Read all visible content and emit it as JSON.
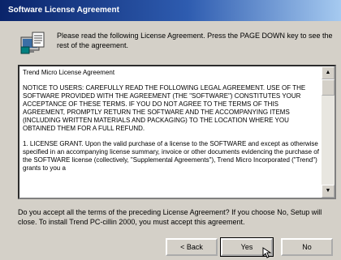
{
  "window": {
    "title": "Software License Agreement"
  },
  "intro": {
    "text": "Please read the following License Agreement. Press the PAGE DOWN key to see the rest of the agreement.",
    "icon": "license-agreement-icon"
  },
  "license": {
    "heading": "Trend Micro License Agreement",
    "notice": "NOTICE TO USERS: CAREFULLY READ THE FOLLOWING LEGAL AGREEMENT. USE OF THE SOFTWARE PROVIDED WITH THE AGREEMENT (THE \"SOFTWARE\") CONSTITUTES YOUR ACCEPTANCE OF THESE TERMS. IF YOU DO NOT AGREE TO THE TERMS OF THIS AGREEMENT, PROMPTLY RETURN THE SOFTWARE AND THE ACCOMPANYING ITEMS (INCLUDING WRITTEN MATERIALS AND PACKAGING) TO THE LOCATION WHERE YOU OBTAINED THEM FOR A FULL REFUND.",
    "grant": "1. LICENSE GRANT. Upon the valid purchase of a license to the SOFTWARE and except as otherwise specified in an accompanying license summary, invoice or other documents evidencing the purchase of the SOFTWARE license (collectively, \"Supplemental Agreements\"), Trend Micro Incorporated (\"Trend\") grants to you a"
  },
  "question": {
    "text": "Do you accept all the terms of the preceding License Agreement? If you choose No, Setup will close. To install Trend PC-cillin 2000, you must accept this agreement."
  },
  "buttons": {
    "back": "< Back",
    "yes": "Yes",
    "no": "No"
  }
}
